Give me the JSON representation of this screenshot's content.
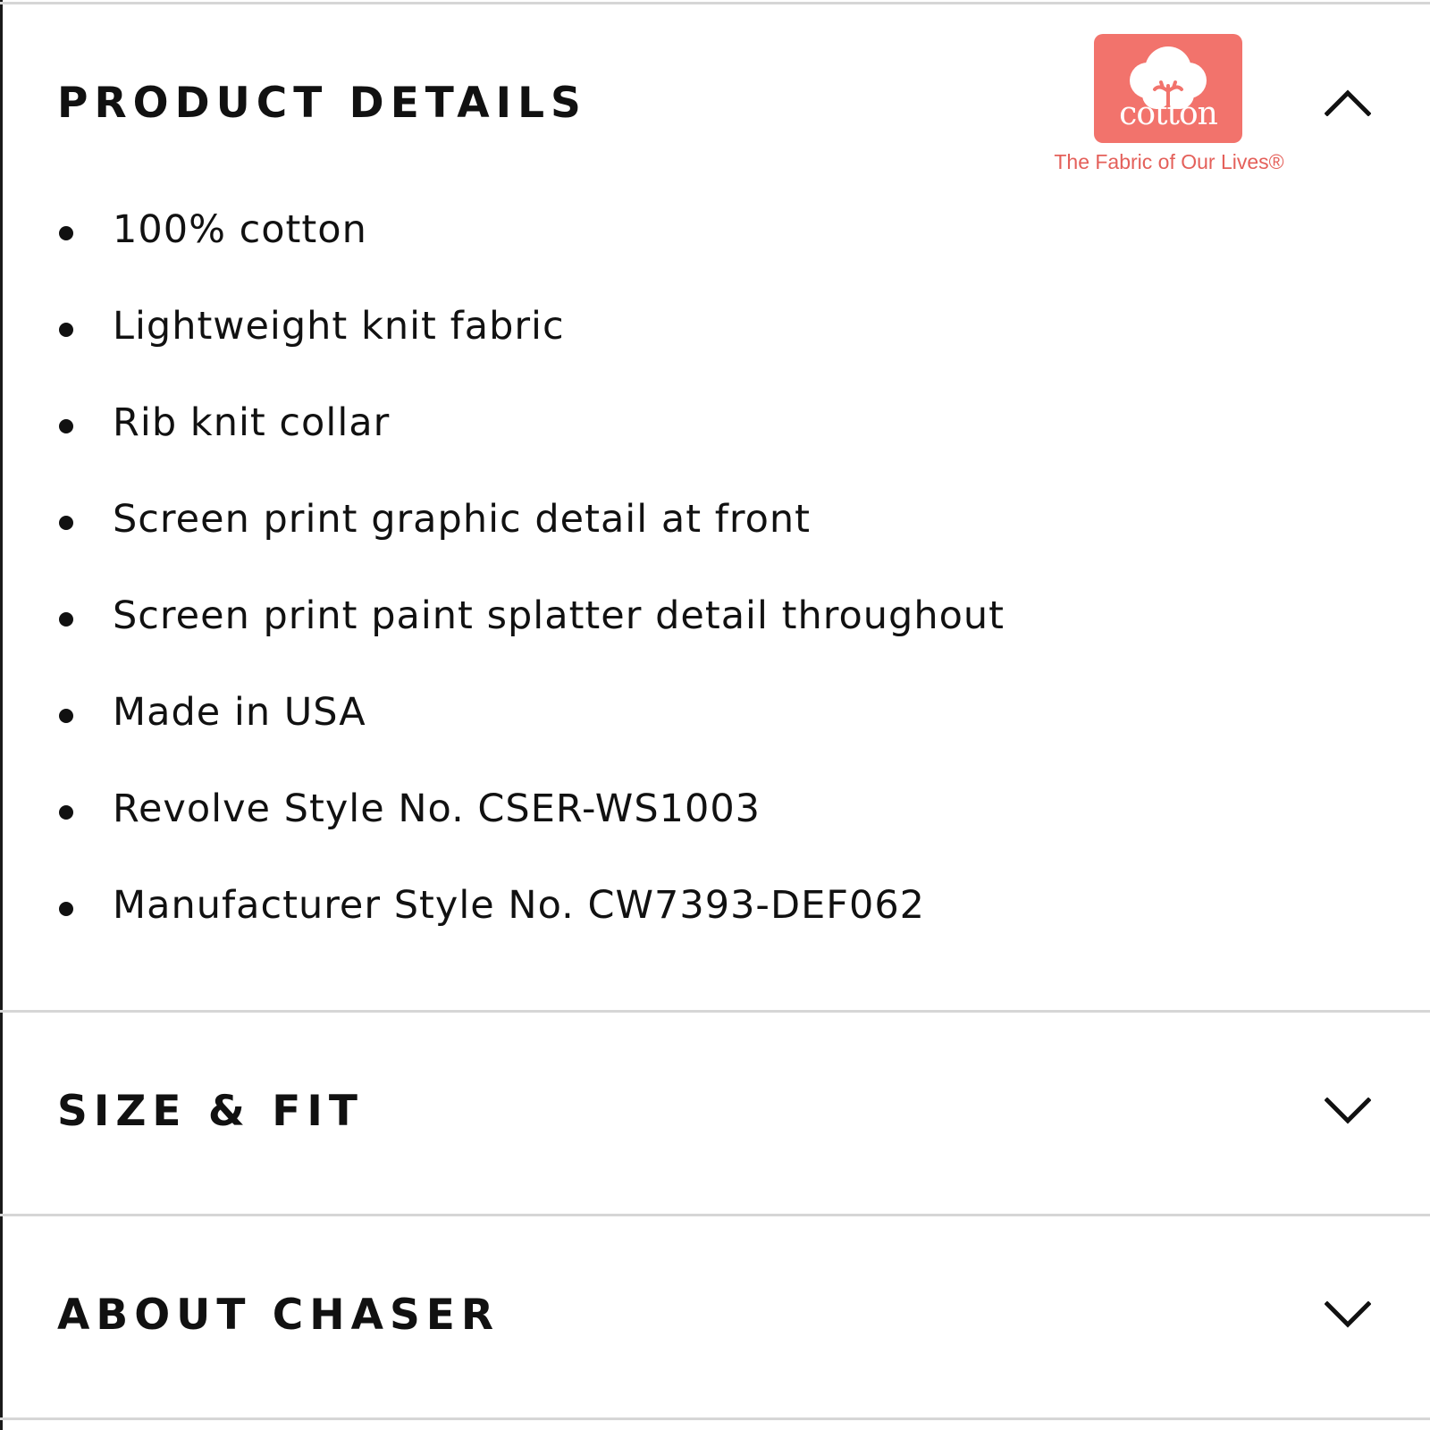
{
  "product_details": {
    "title": "PRODUCT DETAILS",
    "expanded": true,
    "toggle_icon": "chevron-up-icon",
    "items": [
      "100% cotton",
      "Lightweight knit fabric",
      "Rib knit collar",
      "Screen print graphic detail at front",
      "Screen print paint splatter detail throughout",
      "Made in USA",
      "Revolve Style No. CSER-WS1003",
      "Manufacturer Style No. CW7393-DEF062"
    ],
    "cotton_logo": {
      "wordmark": "cotton",
      "tagline": "The Fabric of Our Lives®",
      "brand_color": "#f2736c"
    }
  },
  "size_fit": {
    "title": "SIZE & FIT",
    "expanded": false,
    "toggle_icon": "chevron-down-icon"
  },
  "about_brand": {
    "title": "ABOUT CHASER",
    "expanded": false,
    "toggle_icon": "chevron-down-icon"
  },
  "colors": {
    "text": "#111111",
    "divider": "#d6d6d6",
    "logo": "#f2736c"
  }
}
